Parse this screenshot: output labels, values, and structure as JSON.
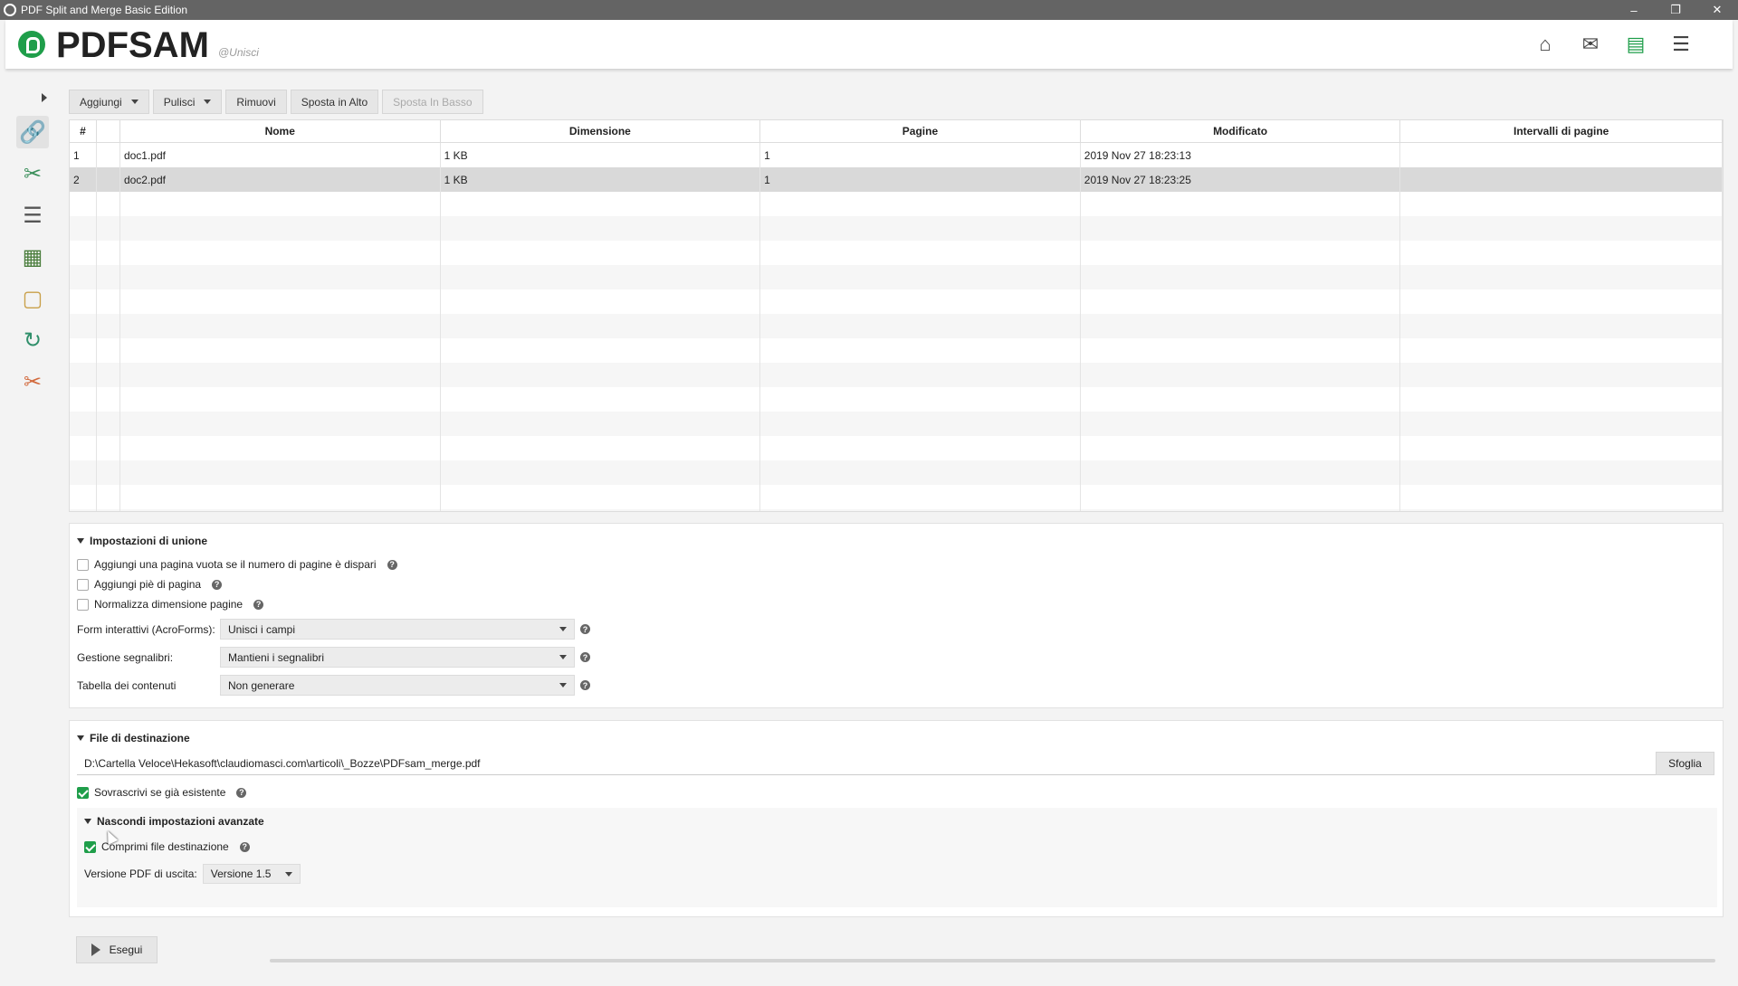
{
  "window": {
    "title": "PDF Split and Merge Basic Edition"
  },
  "header": {
    "logo": "PDFSAM",
    "module": "@Unisci"
  },
  "toolbar": {
    "add": "Aggiungi",
    "clear": "Pulisci",
    "remove": "Rimuovi",
    "move_up": "Sposta in Alto",
    "move_down": "Sposta In Basso"
  },
  "table": {
    "columns": [
      "#",
      "",
      "Nome",
      "Dimensione",
      "Pagine",
      "Modificato",
      "Intervalli di pagine"
    ],
    "rows": [
      {
        "num": "1",
        "name": "doc1.pdf",
        "size": "1 KB",
        "pages": "1",
        "modified": "2019 Nov 27 18:23:13",
        "ranges": ""
      },
      {
        "num": "2",
        "name": "doc2.pdf",
        "size": "1 KB",
        "pages": "1",
        "modified": "2019 Nov 27 18:23:25",
        "ranges": ""
      }
    ]
  },
  "merge_settings": {
    "title": "Impostazioni di unione",
    "blank_page": "Aggiungi una pagina vuota se il numero di pagine è dispari",
    "footer": "Aggiungi piè di pagina",
    "normalize": "Normalizza dimensione pagine",
    "acroforms_label": "Form interattivi (AcroForms):",
    "acroforms_value": "Unisci i campi",
    "bookmarks_label": "Gestione segnalibri:",
    "bookmarks_value": "Mantieni i segnalibri",
    "toc_label": "Tabella dei contenuti",
    "toc_value": "Non generare"
  },
  "destination": {
    "title": "File di destinazione",
    "path": "D:\\Cartella Veloce\\Hekasoft\\claudiomasci.com\\articoli\\_Bozze\\PDFsam_merge.pdf",
    "browse": "Sfoglia",
    "overwrite": "Sovrascrivi se già esistente",
    "advanced_toggle": "Nascondi impostazioni avanzate",
    "compress": "Comprimi file destinazione",
    "version_label": "Versione PDF di uscita:",
    "version_value": "Versione 1.5"
  },
  "run": {
    "label": "Esegui"
  },
  "colors": {
    "accent": "#1f9e4a",
    "titlebar": "#646464"
  }
}
